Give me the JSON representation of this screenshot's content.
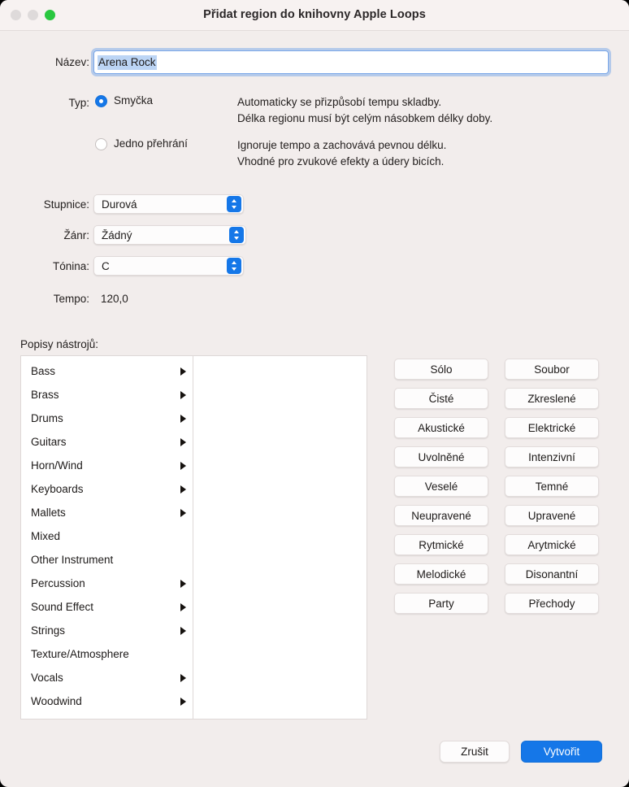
{
  "window": {
    "title": "Přidat region do knihovny Apple Loops",
    "traffic_lights": [
      "close",
      "minimize",
      "zoom"
    ],
    "accent_color": "#1577e8",
    "background_color": "#f2edec",
    "titlebar_color": "#f7f2f1"
  },
  "name": {
    "label": "Název:",
    "value": "Arena Rock",
    "selected": true
  },
  "type": {
    "label": "Typ:",
    "options": [
      {
        "label": "Smyčka",
        "selected": true,
        "description_line1": "Automaticky se přizpůsobí tempu skladby.",
        "description_line2": "Délka regionu musí být celým násobkem délky doby."
      },
      {
        "label": "Jedno přehrání",
        "selected": false,
        "description_line1": "Ignoruje tempo a zachovává pevnou délku.",
        "description_line2": "Vhodné pro zvukové efekty a údery bicích."
      }
    ]
  },
  "popups": {
    "scale": {
      "label": "Stupnice:",
      "value": "Durová"
    },
    "genre": {
      "label": "Žánr:",
      "value": "Žádný"
    },
    "key": {
      "label": "Tónina:",
      "value": "C"
    }
  },
  "tempo": {
    "label": "Tempo:",
    "value": "120,0"
  },
  "browser": {
    "title": "Popisy nástrojů:",
    "items": [
      {
        "label": "Bass",
        "has_submenu": true
      },
      {
        "label": "Brass",
        "has_submenu": true
      },
      {
        "label": "Drums",
        "has_submenu": true
      },
      {
        "label": "Guitars",
        "has_submenu": true
      },
      {
        "label": "Horn/Wind",
        "has_submenu": true
      },
      {
        "label": "Keyboards",
        "has_submenu": true
      },
      {
        "label": "Mallets",
        "has_submenu": true
      },
      {
        "label": "Mixed",
        "has_submenu": false
      },
      {
        "label": "Other Instrument",
        "has_submenu": false
      },
      {
        "label": "Percussion",
        "has_submenu": true
      },
      {
        "label": "Sound Effect",
        "has_submenu": true
      },
      {
        "label": "Strings",
        "has_submenu": true
      },
      {
        "label": "Texture/Atmosphere",
        "has_submenu": false
      },
      {
        "label": "Vocals",
        "has_submenu": true
      },
      {
        "label": "Woodwind",
        "has_submenu": true
      }
    ]
  },
  "tags": [
    "Sólo",
    "Soubor",
    "Čisté",
    "Zkreslené",
    "Akustické",
    "Elektrické",
    "Uvolněné",
    "Intenzivní",
    "Veselé",
    "Temné",
    "Neupravené",
    "Upravené",
    "Rytmické",
    "Arytmické",
    "Melodické",
    "Disonantní",
    "Party",
    "Přechody"
  ],
  "footer": {
    "cancel_label": "Zrušit",
    "create_label": "Vytvořit"
  }
}
